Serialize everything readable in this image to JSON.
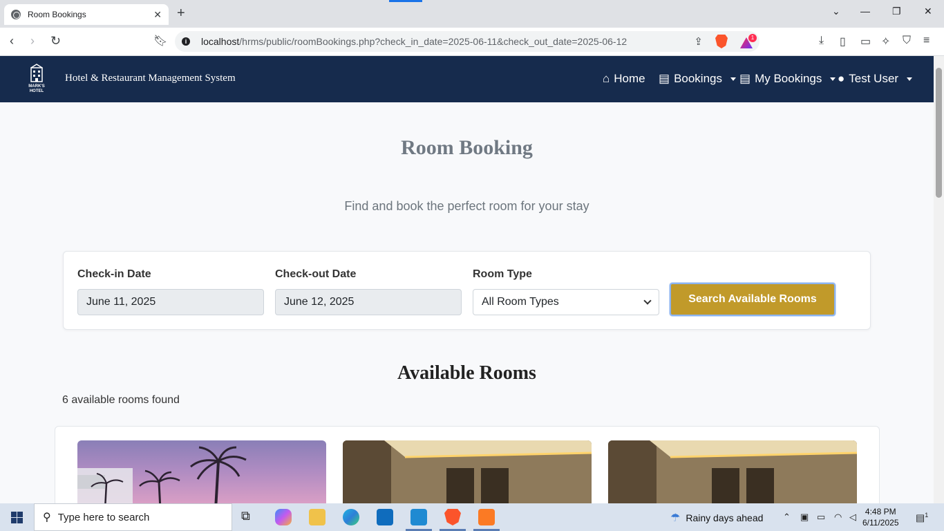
{
  "browser": {
    "tab_title": "Room Bookings",
    "new_tab": "+",
    "url_host": "localhost",
    "url_rest": "/hrms/public/roomBookings.php?check_in_date=2025-06-11&check_out_date=2025-06-12",
    "notification_count": "1"
  },
  "site": {
    "brand": "Hotel & Restaurant Management System",
    "logo_text": "MARK'S HOTEL",
    "nav": {
      "home": "Home",
      "bookings": "Bookings",
      "my_bookings": "My Bookings",
      "user": "Test User"
    }
  },
  "main": {
    "title": "Room Booking",
    "subtitle": "Find and book the perfect room for your stay",
    "search": {
      "checkin_label": "Check-in Date",
      "checkin_value": "June 11, 2025",
      "checkout_label": "Check-out Date",
      "checkout_value": "June 12, 2025",
      "roomtype_label": "Room Type",
      "roomtype_value": "All Room Types",
      "button": "Search Available Rooms"
    },
    "available_title": "Available Rooms",
    "available_count": "6 available rooms found"
  },
  "taskbar": {
    "search_placeholder": "Type here to search",
    "weather": "Rainy days ahead",
    "time": "4:48 PM",
    "date": "6/11/2025",
    "notif_count": "1"
  },
  "colors": {
    "navbar": "#162b4d",
    "accent_gold": "#c19a2a",
    "page_bg": "#f8f9fb"
  }
}
